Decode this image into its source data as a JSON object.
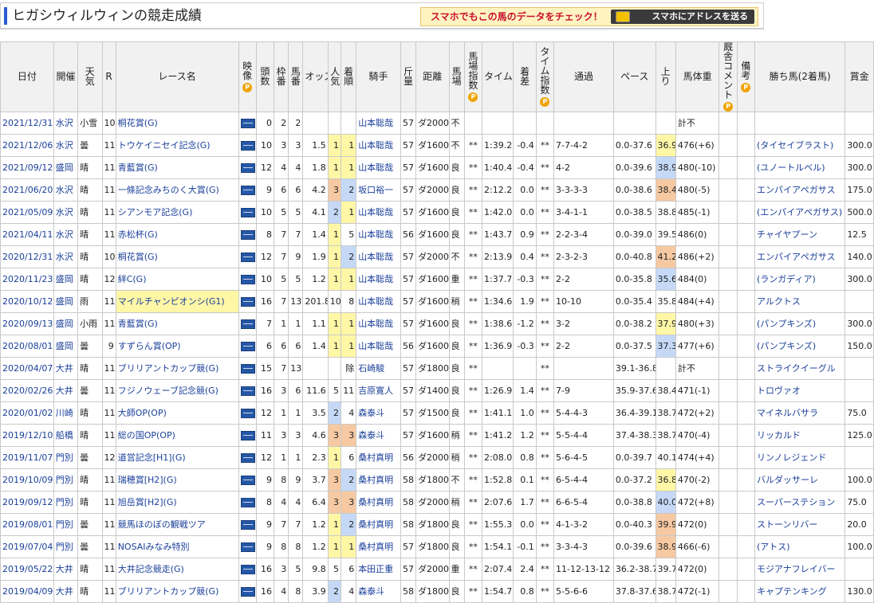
{
  "page": {
    "title": "ヒガシウィルウィンの競走成績",
    "promo_text": "スマホでもこの馬のデータをチェック！",
    "promo_button": "スマホにアドレスを送る"
  },
  "headers": [
    "日付",
    "開催",
    "天気",
    "R",
    "レース名",
    "映像",
    "頭数",
    "枠番",
    "馬番",
    "オッズ",
    "人気",
    "着順",
    "騎手",
    "斤量",
    "距離",
    "馬場",
    "馬場指数",
    "タイム",
    "着差",
    "タイム指数",
    "通過",
    "ペース",
    "上り",
    "馬体重",
    "厩舎コメント",
    "備考",
    "勝ち馬(2着馬)",
    "賞金"
  ],
  "rows": [
    {
      "date": "2021/12/31",
      "venue": "水沢",
      "weather": "小雪",
      "r": "10",
      "race": "桐花賞(G)",
      "heads": "0",
      "waku": "2",
      "umaban": "2",
      "odds": "",
      "pop": "",
      "pop_c": "",
      "rank": "",
      "rank_c": "",
      "jockey": "山本聡哉",
      "kin": "57",
      "dist": "ダ2000",
      "baba": "不",
      "bidx": "",
      "time": "",
      "diff": "",
      "tidx": "",
      "pass": "",
      "pace": "",
      "up": "",
      "up_c": "",
      "weight": "計不",
      "winner": "",
      "prize": ""
    },
    {
      "date": "2021/12/06",
      "venue": "水沢",
      "weather": "曇",
      "r": "11",
      "race": "トウケイニセイ記念(G)",
      "heads": "10",
      "waku": "3",
      "umaban": "3",
      "odds": "1.5",
      "pop": "1",
      "pop_c": "y",
      "rank": "1",
      "rank_c": "y",
      "jockey": "山本聡哉",
      "kin": "57",
      "dist": "ダ1600",
      "baba": "不",
      "bidx": "**",
      "time": "1:39.2",
      "diff": "-0.4",
      "tidx": "**",
      "pass": "7-7-4-2",
      "pace": "0.0-37.6",
      "up": "36.9",
      "up_c": "y",
      "weight": "476(+6)",
      "winner": "(タイセイブラスト)",
      "prize": "300.0"
    },
    {
      "date": "2021/09/12",
      "venue": "盛岡",
      "weather": "晴",
      "r": "11",
      "race": "青藍賞(G)",
      "heads": "12",
      "waku": "4",
      "umaban": "4",
      "odds": "1.8",
      "pop": "1",
      "pop_c": "y",
      "rank": "1",
      "rank_c": "y",
      "jockey": "山本聡哉",
      "kin": "57",
      "dist": "ダ1600",
      "baba": "良",
      "bidx": "**",
      "time": "1:40.4",
      "diff": "-0.4",
      "tidx": "**",
      "pass": "4-2",
      "pace": "0.0-39.6",
      "up": "38.9",
      "up_c": "b",
      "weight": "480(-10)",
      "winner": "(ユノートルベル)",
      "prize": "300.0"
    },
    {
      "date": "2021/06/20",
      "venue": "水沢",
      "weather": "晴",
      "r": "11",
      "race": "一條記念みちのく大賞(G)",
      "heads": "9",
      "waku": "6",
      "umaban": "6",
      "odds": "4.2",
      "pop": "3",
      "pop_c": "o",
      "rank": "2",
      "rank_c": "b",
      "jockey": "坂口裕一",
      "kin": "57",
      "dist": "ダ2000",
      "baba": "良",
      "bidx": "**",
      "time": "2:12.2",
      "diff": "0.0",
      "tidx": "**",
      "pass": "3-3-3-3",
      "pace": "0.0-38.6",
      "up": "38.4",
      "up_c": "o",
      "weight": "480(-5)",
      "winner": "エンパイアペガサス",
      "prize": "175.0"
    },
    {
      "date": "2021/05/09",
      "venue": "水沢",
      "weather": "晴",
      "r": "11",
      "race": "シアンモア記念(G)",
      "heads": "10",
      "waku": "5",
      "umaban": "5",
      "odds": "4.1",
      "pop": "2",
      "pop_c": "b",
      "rank": "1",
      "rank_c": "y",
      "jockey": "山本聡哉",
      "kin": "57",
      "dist": "ダ1600",
      "baba": "良",
      "bidx": "**",
      "time": "1:42.0",
      "diff": "0.0",
      "tidx": "**",
      "pass": "3-4-1-1",
      "pace": "0.0-38.5",
      "up": "38.8",
      "up_c": "",
      "weight": "485(-1)",
      "winner": "(エンパイアペガサス)",
      "prize": "500.0"
    },
    {
      "date": "2021/04/11",
      "venue": "水沢",
      "weather": "晴",
      "r": "11",
      "race": "赤松杯(G)",
      "heads": "8",
      "waku": "7",
      "umaban": "7",
      "odds": "1.4",
      "pop": "1",
      "pop_c": "y",
      "rank": "5",
      "rank_c": "",
      "jockey": "山本聡哉",
      "kin": "56",
      "dist": "ダ1600",
      "baba": "良",
      "bidx": "**",
      "time": "1:43.7",
      "diff": "0.9",
      "tidx": "**",
      "pass": "2-2-3-4",
      "pace": "0.0-39.0",
      "up": "39.5",
      "up_c": "",
      "weight": "486(0)",
      "winner": "チャイヤプーン",
      "prize": "12.5"
    },
    {
      "date": "2020/12/31",
      "venue": "水沢",
      "weather": "晴",
      "r": "10",
      "race": "桐花賞(G)",
      "heads": "12",
      "waku": "7",
      "umaban": "9",
      "odds": "1.9",
      "pop": "1",
      "pop_c": "y",
      "rank": "2",
      "rank_c": "b",
      "jockey": "山本聡哉",
      "kin": "57",
      "dist": "ダ2000",
      "baba": "不",
      "bidx": "**",
      "time": "2:13.9",
      "diff": "0.4",
      "tidx": "**",
      "pass": "2-3-2-3",
      "pace": "0.0-40.8",
      "up": "41.2",
      "up_c": "o",
      "weight": "486(+2)",
      "winner": "エンパイアペガサス",
      "prize": "140.0"
    },
    {
      "date": "2020/11/23",
      "venue": "盛岡",
      "weather": "晴",
      "r": "12",
      "race": "絆C(G)",
      "heads": "10",
      "waku": "5",
      "umaban": "5",
      "odds": "1.2",
      "pop": "1",
      "pop_c": "y",
      "rank": "1",
      "rank_c": "y",
      "jockey": "山本聡哉",
      "kin": "57",
      "dist": "ダ1600",
      "baba": "重",
      "bidx": "**",
      "time": "1:37.7",
      "diff": "-0.3",
      "tidx": "**",
      "pass": "2-2",
      "pace": "0.0-35.8",
      "up": "35.6",
      "up_c": "b",
      "weight": "484(0)",
      "winner": "(ランガディア)",
      "prize": "300.0"
    },
    {
      "date": "2020/10/12",
      "venue": "盛岡",
      "weather": "雨",
      "r": "11",
      "race": "マイルチャンピオンシ(G1)",
      "race_hl": true,
      "heads": "16",
      "waku": "7",
      "umaban": "13",
      "odds": "201.8",
      "pop": "10",
      "pop_c": "",
      "rank": "8",
      "rank_c": "",
      "jockey": "山本聡哉",
      "kin": "57",
      "dist": "ダ1600",
      "baba": "稍",
      "bidx": "**",
      "time": "1:34.6",
      "diff": "1.9",
      "tidx": "**",
      "pass": "10-10",
      "pace": "0.0-35.4",
      "up": "35.8",
      "up_c": "",
      "weight": "484(+4)",
      "winner": "アルクトス",
      "prize": ""
    },
    {
      "date": "2020/09/13",
      "venue": "盛岡",
      "weather": "小雨",
      "r": "11",
      "race": "青藍賞(G)",
      "heads": "7",
      "waku": "1",
      "umaban": "1",
      "odds": "1.1",
      "pop": "1",
      "pop_c": "y",
      "rank": "1",
      "rank_c": "y",
      "jockey": "山本聡哉",
      "kin": "57",
      "dist": "ダ1600",
      "baba": "良",
      "bidx": "**",
      "time": "1:38.6",
      "diff": "-1.2",
      "tidx": "**",
      "pass": "3-2",
      "pace": "0.0-38.2",
      "up": "37.9",
      "up_c": "y",
      "weight": "480(+3)",
      "winner": "(パンプキンズ)",
      "prize": "300.0"
    },
    {
      "date": "2020/08/01",
      "venue": "盛岡",
      "weather": "曇",
      "r": "9",
      "race": "すずらん賞(OP)",
      "heads": "6",
      "waku": "6",
      "umaban": "6",
      "odds": "1.4",
      "pop": "1",
      "pop_c": "y",
      "rank": "1",
      "rank_c": "y",
      "jockey": "山本聡哉",
      "kin": "56",
      "dist": "ダ1600",
      "baba": "良",
      "bidx": "**",
      "time": "1:36.9",
      "diff": "-0.3",
      "tidx": "**",
      "pass": "2-2",
      "pace": "0.0-37.5",
      "up": "37.3",
      "up_c": "b",
      "weight": "477(+6)",
      "winner": "(パンプキンズ)",
      "prize": "150.0"
    },
    {
      "date": "2020/04/07",
      "venue": "大井",
      "weather": "晴",
      "r": "11",
      "race": "ブリリアントカップ競(G)",
      "heads": "15",
      "waku": "7",
      "umaban": "13",
      "odds": "",
      "pop": "",
      "pop_c": "",
      "rank": "除",
      "rank_c": "",
      "jockey": "石崎駿",
      "kin": "57",
      "dist": "ダ1800",
      "baba": "良",
      "bidx": "**",
      "time": "",
      "diff": "",
      "tidx": "**",
      "pass": "",
      "pace": "39.1-36.8",
      "up": "",
      "up_c": "",
      "weight": "計不",
      "winner": "ストライクイーグル",
      "prize": ""
    },
    {
      "date": "2020/02/26",
      "venue": "大井",
      "weather": "曇",
      "r": "11",
      "race": "フジノウェーブ記念競(G)",
      "heads": "16",
      "waku": "3",
      "umaban": "6",
      "odds": "11.6",
      "pop": "5",
      "pop_c": "",
      "rank": "11",
      "rank_c": "",
      "jockey": "吉原寛人",
      "kin": "57",
      "dist": "ダ1400",
      "baba": "良",
      "bidx": "**",
      "time": "1:26.9",
      "diff": "1.4",
      "tidx": "**",
      "pass": "7-9",
      "pace": "35.9-37.6",
      "up": "38.4",
      "up_c": "",
      "weight": "471(-1)",
      "winner": "トロヴァオ",
      "prize": ""
    },
    {
      "date": "2020/01/02",
      "venue": "川崎",
      "weather": "晴",
      "r": "11",
      "race": "大師OP(OP)",
      "heads": "12",
      "waku": "1",
      "umaban": "1",
      "odds": "3.5",
      "pop": "2",
      "pop_c": "b",
      "rank": "4",
      "rank_c": "",
      "jockey": "森泰斗",
      "kin": "57",
      "dist": "ダ1500",
      "baba": "良",
      "bidx": "**",
      "time": "1:41.1",
      "diff": "1.0",
      "tidx": "**",
      "pass": "5-4-4-3",
      "pace": "36.4-39.1",
      "up": "38.7",
      "up_c": "",
      "weight": "472(+2)",
      "winner": "マイネルバサラ",
      "prize": "75.0"
    },
    {
      "date": "2019/12/10",
      "venue": "船橋",
      "weather": "晴",
      "r": "11",
      "race": "総の国OP(OP)",
      "heads": "11",
      "waku": "3",
      "umaban": "3",
      "odds": "4.6",
      "pop": "3",
      "pop_c": "o",
      "rank": "3",
      "rank_c": "o",
      "jockey": "森泰斗",
      "kin": "57",
      "dist": "ダ1600",
      "baba": "稍",
      "bidx": "**",
      "time": "1:41.2",
      "diff": "1.2",
      "tidx": "**",
      "pass": "5-5-4-4",
      "pace": "37.4-38.3",
      "up": "38.7",
      "up_c": "",
      "weight": "470(-4)",
      "winner": "リッカルド",
      "prize": "125.0"
    },
    {
      "date": "2019/11/07",
      "venue": "門別",
      "weather": "曇",
      "r": "12",
      "race": "道営記念[H1](G)",
      "heads": "12",
      "waku": "1",
      "umaban": "1",
      "odds": "2.3",
      "pop": "1",
      "pop_c": "y",
      "rank": "6",
      "rank_c": "",
      "jockey": "桑村真明",
      "kin": "56",
      "dist": "ダ2000",
      "baba": "稍",
      "bidx": "**",
      "time": "2:08.0",
      "diff": "0.8",
      "tidx": "**",
      "pass": "5-6-4-5",
      "pace": "0.0-39.7",
      "up": "40.1",
      "up_c": "",
      "weight": "474(+4)",
      "winner": "リンノレジェンド",
      "prize": ""
    },
    {
      "date": "2019/10/09",
      "venue": "門別",
      "weather": "晴",
      "r": "11",
      "race": "瑞穂賞[H2](G)",
      "heads": "9",
      "waku": "8",
      "umaban": "9",
      "odds": "3.7",
      "pop": "3",
      "pop_c": "o",
      "rank": "2",
      "rank_c": "b",
      "jockey": "桑村真明",
      "kin": "58",
      "dist": "ダ1800",
      "baba": "不",
      "bidx": "**",
      "time": "1:52.8",
      "diff": "0.1",
      "tidx": "**",
      "pass": "6-5-4-4",
      "pace": "0.0-37.2",
      "up": "36.8",
      "up_c": "y",
      "weight": "470(-2)",
      "winner": "バルダッサーレ",
      "prize": "100.0"
    },
    {
      "date": "2019/09/12",
      "venue": "門別",
      "weather": "晴",
      "r": "11",
      "race": "旭岳賞[H2](G)",
      "heads": "8",
      "waku": "4",
      "umaban": "4",
      "odds": "6.4",
      "pop": "3",
      "pop_c": "o",
      "rank": "3",
      "rank_c": "o",
      "jockey": "桑村真明",
      "kin": "58",
      "dist": "ダ2000",
      "baba": "稍",
      "bidx": "**",
      "time": "2:07.6",
      "diff": "1.7",
      "tidx": "**",
      "pass": "6-6-5-4",
      "pace": "0.0-38.8",
      "up": "40.0",
      "up_c": "b",
      "weight": "472(+8)",
      "winner": "スーパーステション",
      "prize": "75.0"
    },
    {
      "date": "2019/08/01",
      "venue": "門別",
      "weather": "曇",
      "r": "11",
      "race": "競馬ほのぼの観戦ツア",
      "heads": "9",
      "waku": "7",
      "umaban": "7",
      "odds": "1.2",
      "pop": "1",
      "pop_c": "y",
      "rank": "2",
      "rank_c": "b",
      "jockey": "桑村真明",
      "kin": "58",
      "dist": "ダ1800",
      "baba": "良",
      "bidx": "**",
      "time": "1:55.3",
      "diff": "0.0",
      "tidx": "**",
      "pass": "4-1-3-2",
      "pace": "0.0-40.3",
      "up": "39.9",
      "up_c": "o",
      "weight": "472(0)",
      "winner": "ストーンリバー",
      "prize": "20.0"
    },
    {
      "date": "2019/07/04",
      "venue": "門別",
      "weather": "曇",
      "r": "11",
      "race": "NOSAIみなみ特別",
      "heads": "9",
      "waku": "8",
      "umaban": "8",
      "odds": "1.2",
      "pop": "1",
      "pop_c": "y",
      "rank": "1",
      "rank_c": "y",
      "jockey": "桑村真明",
      "kin": "57",
      "dist": "ダ1800",
      "baba": "良",
      "bidx": "**",
      "time": "1:54.1",
      "diff": "-0.1",
      "tidx": "**",
      "pass": "3-3-4-3",
      "pace": "0.0-39.6",
      "up": "38.9",
      "up_c": "o",
      "weight": "466(-6)",
      "winner": "(アトス)",
      "prize": "100.0"
    },
    {
      "date": "2019/05/22",
      "venue": "大井",
      "weather": "晴",
      "r": "11",
      "race": "大井記念競走(G)",
      "heads": "16",
      "waku": "3",
      "umaban": "5",
      "odds": "9.8",
      "pop": "5",
      "pop_c": "",
      "rank": "6",
      "rank_c": "",
      "jockey": "本田正重",
      "kin": "57",
      "dist": "ダ2000",
      "baba": "重",
      "bidx": "**",
      "time": "2:07.4",
      "diff": "2.4",
      "tidx": "**",
      "pass": "11-12-13-12",
      "pace": "36.2-38.7",
      "up": "39.7",
      "up_c": "",
      "weight": "472(0)",
      "winner": "モジアナフレイバー",
      "prize": ""
    },
    {
      "date": "2019/04/09",
      "venue": "大井",
      "weather": "晴",
      "r": "11",
      "race": "ブリリアントカップ競(G)",
      "heads": "16",
      "waku": "4",
      "umaban": "8",
      "odds": "3.9",
      "pop": "2",
      "pop_c": "b",
      "rank": "4",
      "rank_c": "",
      "jockey": "森泰斗",
      "kin": "58",
      "dist": "ダ1800",
      "baba": "良",
      "bidx": "**",
      "time": "1:54.7",
      "diff": "0.8",
      "tidx": "**",
      "pass": "5-5-6-6",
      "pace": "37.8-37.6",
      "up": "38.7",
      "up_c": "",
      "weight": "472(-1)",
      "winner": "キャプテンキング",
      "prize": "130.0"
    }
  ]
}
